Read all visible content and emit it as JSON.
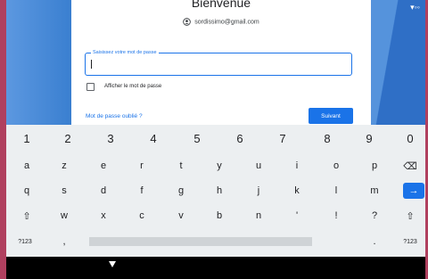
{
  "dialog": {
    "title": "Bienvenue",
    "account_email": "sordissimo@gmail.com",
    "password_label": "Saisissez votre mot de passe",
    "password_value": "",
    "show_password_label": "Afficher le mot de passe",
    "show_password_checked": false,
    "forgot_password_link": "Mot de passe oublié ?",
    "next_button": "Suivant"
  },
  "keyboard": {
    "number_row": [
      "1",
      "2",
      "3",
      "4",
      "5",
      "6",
      "7",
      "8",
      "9",
      "0"
    ],
    "row1": [
      "a",
      "z",
      "e",
      "r",
      "t",
      "y",
      "u",
      "i",
      "o",
      "p"
    ],
    "row1_end": "⌫",
    "row2": [
      "q",
      "s",
      "d",
      "f",
      "g",
      "h",
      "j",
      "k",
      "l",
      "m"
    ],
    "row2_end": "→",
    "row3_start": "⇧",
    "row3": [
      "w",
      "x",
      "c",
      "v",
      "b",
      "n",
      "'",
      "!",
      "?"
    ],
    "row3_end": "⇧",
    "bottom_left": "?123",
    "bottom_comma": ",",
    "bottom_period": ".",
    "bottom_right": "?123"
  },
  "colors": {
    "accent": "#1a73e8",
    "background_blue": "#3f83d4",
    "frame": "#b0405f"
  },
  "status_bar": {
    "icons": "▾◦◦"
  }
}
